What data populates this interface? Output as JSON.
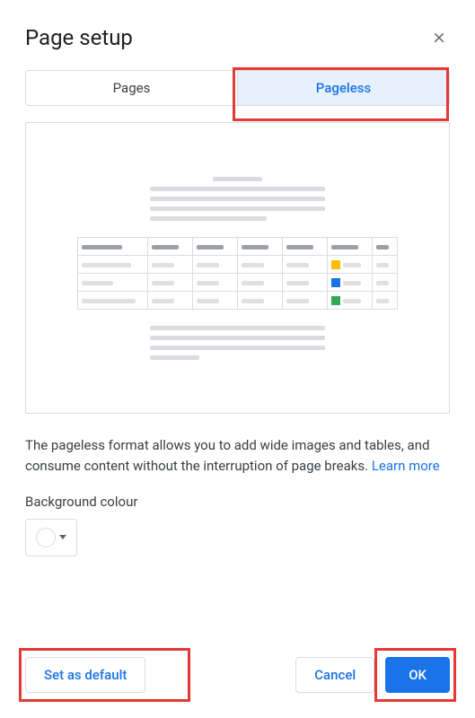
{
  "dialog": {
    "title": "Page setup"
  },
  "tabs": {
    "pages": "Pages",
    "pageless": "Pageless"
  },
  "description": {
    "text": "The pageless format allows you to add wide images and tables, and consume content without the interruption of page breaks. ",
    "learn_more": "Learn more"
  },
  "background": {
    "label": "Background colour"
  },
  "buttons": {
    "set_default": "Set as default",
    "cancel": "Cancel",
    "ok": "OK"
  }
}
